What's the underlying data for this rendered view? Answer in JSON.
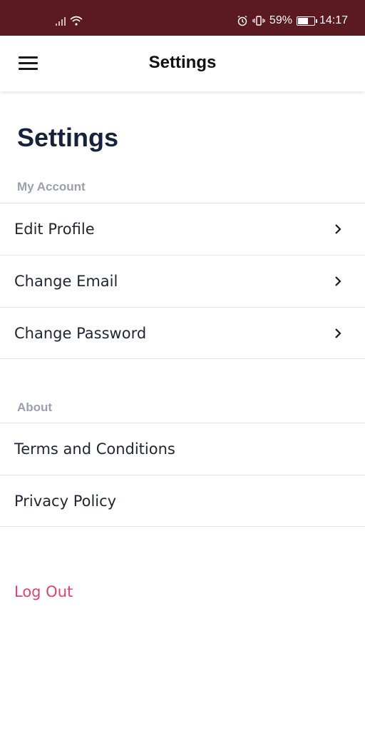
{
  "status_bar": {
    "battery_percent": "59%",
    "battery_level": 0.59,
    "time": "14:17",
    "bg_color": "#5a1a1f"
  },
  "app_bar": {
    "menu_icon": "hamburger-menu-icon",
    "title": "Settings"
  },
  "page": {
    "title": "Settings"
  },
  "my_account": {
    "header": "My Account",
    "items": [
      {
        "label": "Edit Profile",
        "icon": "chevron-right-icon"
      },
      {
        "label": "Change Email",
        "icon": "chevron-right-icon"
      },
      {
        "label": "Change Password",
        "icon": "chevron-right-icon"
      }
    ]
  },
  "about": {
    "header": "About",
    "items": [
      {
        "label": "Terms and Conditions"
      },
      {
        "label": "Privacy Policy"
      }
    ]
  },
  "logout": {
    "label": "Log Out",
    "color": "#e53f74"
  }
}
